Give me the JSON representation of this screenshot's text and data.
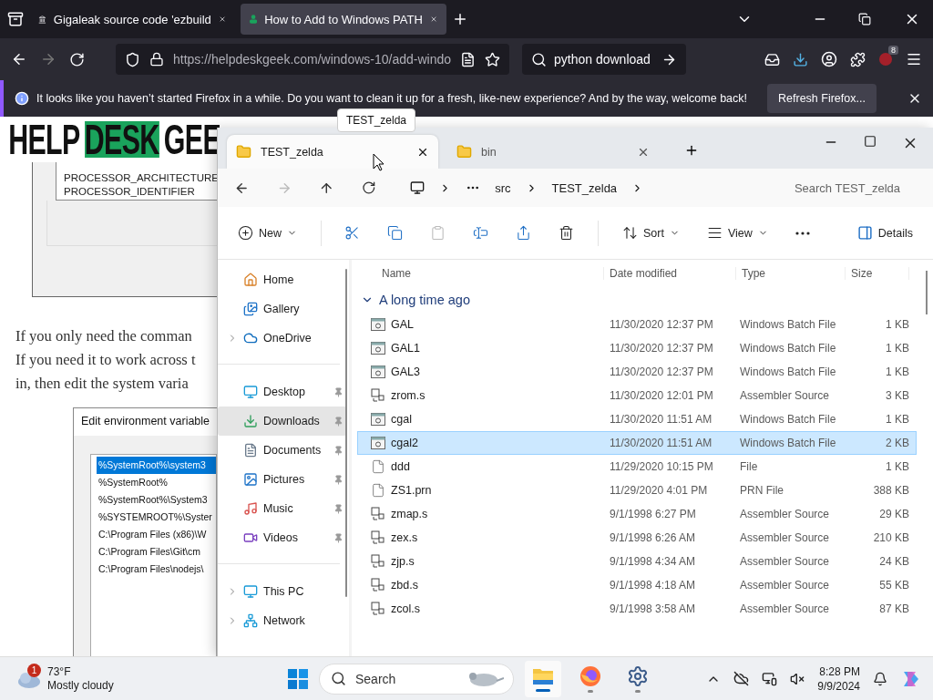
{
  "browser": {
    "tabs": [
      {
        "title": "Gigaleak source code 'ezbuild",
        "selected": false
      },
      {
        "title": "How to Add to Windows PATH",
        "selected": true
      }
    ],
    "url": "https://helpdeskgeek.com/windows-10/add-windo",
    "search": "python download",
    "extension_badge": "8",
    "notification": {
      "message": "It looks like you haven’t started Firefox in a while. Do you want to clean it up for a fresh, like-new experience? And by the way, welcome back!",
      "button": "Refresh Firefox..."
    }
  },
  "tooltip": "TEST_zelda",
  "article": {
    "logo": [
      "HELP",
      "DESK",
      "GEE"
    ],
    "screenshot_items": [
      "PROCESSOR_ARCHITECTURE",
      "PROCESSOR_IDENTIFIER"
    ],
    "paragraph_lines": [
      "If you only need the comman",
      "If you need it to work across t",
      "in, then edit the system varia"
    ],
    "dialog": {
      "title": "Edit environment variable",
      "items": [
        {
          "text": "%SystemRoot%\\system3",
          "selected": true
        },
        {
          "text": "%SystemRoot%",
          "selected": false
        },
        {
          "text": "%SystemRoot%\\System3",
          "selected": false
        },
        {
          "text": "%SYSTEMROOT%\\Syster",
          "selected": false
        },
        {
          "text": "C:\\Program Files (x86)\\W",
          "selected": false
        },
        {
          "text": "C:\\Program Files\\Git\\cm",
          "selected": false
        },
        {
          "text": "C:\\Program Files\\nodejs\\",
          "selected": false
        }
      ]
    }
  },
  "explorer": {
    "tabs": [
      {
        "title": "TEST_zelda",
        "selected": true
      },
      {
        "title": "bin",
        "selected": false
      }
    ],
    "breadcrumb": [
      "src",
      "TEST_zelda"
    ],
    "search_placeholder": "Search TEST_zelda",
    "commands": [
      {
        "kind": "new",
        "label": "New",
        "disabled": false
      },
      {
        "kind": "cut",
        "disabled": false
      },
      {
        "kind": "copy",
        "disabled": false
      },
      {
        "kind": "paste",
        "disabled": true
      },
      {
        "kind": "rename",
        "disabled": false
      },
      {
        "kind": "share",
        "disabled": false
      },
      {
        "kind": "delete",
        "disabled": false
      },
      {
        "kind": "sort",
        "label": "Sort",
        "disabled": false
      },
      {
        "kind": "view",
        "label": "View",
        "disabled": false
      },
      {
        "kind": "more",
        "disabled": false
      }
    ],
    "details_label": "Details",
    "sidebar": [
      {
        "items": [
          {
            "label": "Home",
            "kind": "home",
            "selected": false
          },
          {
            "label": "Gallery",
            "kind": "gallery",
            "selected": false
          },
          {
            "label": "OneDrive",
            "kind": "cloud",
            "selected": false,
            "expanded": false
          }
        ]
      },
      {
        "items": [
          {
            "label": "Desktop",
            "kind": "desktop",
            "selected": false,
            "pinned": true
          },
          {
            "label": "Downloads",
            "kind": "downloads",
            "selected": true,
            "pinned": true
          },
          {
            "label": "Documents",
            "kind": "documents",
            "selected": false,
            "pinned": true
          },
          {
            "label": "Pictures",
            "kind": "pictures",
            "selected": false,
            "pinned": true
          },
          {
            "label": "Music",
            "kind": "music",
            "selected": false,
            "pinned": true
          },
          {
            "label": "Videos",
            "kind": "videos",
            "selected": false,
            "pinned": true
          }
        ]
      },
      {
        "items": [
          {
            "label": "This PC",
            "kind": "pc",
            "selected": false,
            "expanded": false
          },
          {
            "label": "Network",
            "kind": "network",
            "selected": false,
            "expanded": false
          }
        ]
      }
    ],
    "columns": [
      "Name",
      "Date modified",
      "Type",
      "Size"
    ],
    "group": {
      "title": "A long time ago",
      "expanded": true
    },
    "files": [
      {
        "name": "GAL",
        "date": "11/30/2020 12:37 PM",
        "type": "Windows Batch File",
        "size": "1 KB",
        "kind": "batch",
        "selected": false
      },
      {
        "name": "GAL1",
        "date": "11/30/2020 12:37 PM",
        "type": "Windows Batch File",
        "size": "1 KB",
        "kind": "batch",
        "selected": false
      },
      {
        "name": "GAL3",
        "date": "11/30/2020 12:37 PM",
        "type": "Windows Batch File",
        "size": "1 KB",
        "kind": "batch",
        "selected": false
      },
      {
        "name": "zrom.s",
        "date": "11/30/2020 12:01 PM",
        "type": "Assembler Source",
        "size": "3 KB",
        "kind": "asm",
        "selected": false
      },
      {
        "name": "cgal",
        "date": "11/30/2020 11:51 AM",
        "type": "Windows Batch File",
        "size": "1 KB",
        "kind": "batch",
        "selected": false
      },
      {
        "name": "cgal2",
        "date": "11/30/2020 11:51 AM",
        "type": "Windows Batch File",
        "size": "2 KB",
        "kind": "batch",
        "selected": true
      },
      {
        "name": "ddd",
        "date": "11/29/2020 10:15 PM",
        "type": "File",
        "size": "1 KB",
        "kind": "file",
        "selected": false
      },
      {
        "name": "ZS1.prn",
        "date": "11/29/2020 4:01 PM",
        "type": "PRN File",
        "size": "388 KB",
        "kind": "file",
        "selected": false
      },
      {
        "name": "zmap.s",
        "date": "9/1/1998 6:27 PM",
        "type": "Assembler Source",
        "size": "29 KB",
        "kind": "asm",
        "selected": false
      },
      {
        "name": "zex.s",
        "date": "9/1/1998 6:26 AM",
        "type": "Assembler Source",
        "size": "210 KB",
        "kind": "asm",
        "selected": false
      },
      {
        "name": "zjp.s",
        "date": "9/1/1998 4:34 AM",
        "type": "Assembler Source",
        "size": "24 KB",
        "kind": "asm",
        "selected": false
      },
      {
        "name": "zbd.s",
        "date": "9/1/1998 4:18 AM",
        "type": "Assembler Source",
        "size": "55 KB",
        "kind": "asm",
        "selected": false
      },
      {
        "name": "zcol.s",
        "date": "9/1/1998 3:58 AM",
        "type": "Assembler Source",
        "size": "87 KB",
        "kind": "asm",
        "selected": false
      }
    ]
  },
  "taskbar": {
    "weather": {
      "badge": "1",
      "temp": "73°F",
      "condition": "Mostly cloudy"
    },
    "search": "Search",
    "apps": [
      {
        "kind": "explorer",
        "active": true
      },
      {
        "kind": "firefox",
        "active": false
      },
      {
        "kind": "settings",
        "active": false
      }
    ],
    "time": "8:28 PM",
    "date": "9/9/2024"
  }
}
